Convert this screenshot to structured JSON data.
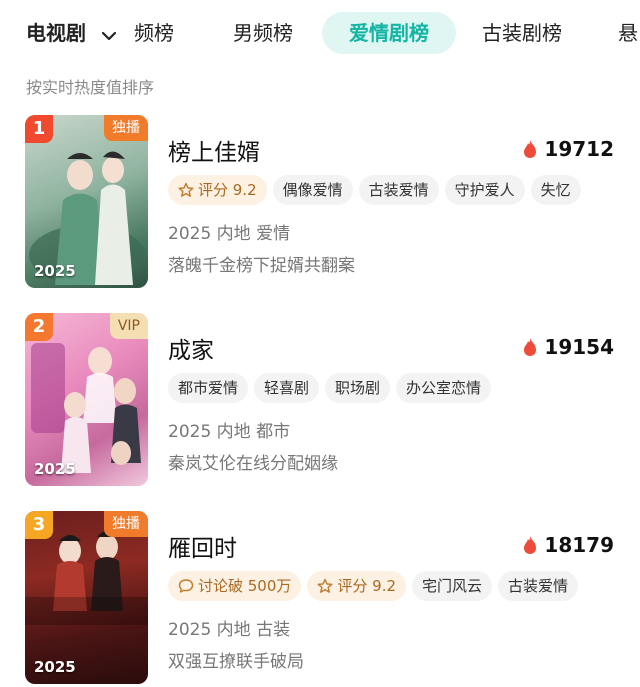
{
  "tabs": {
    "category": "电视剧",
    "items": [
      "频榜",
      "男频榜",
      "爱情剧榜",
      "古装剧榜",
      "悬"
    ]
  },
  "sort_hint": "按实时热度值排序",
  "colors": {
    "accent": "#14b5a3",
    "heat_flame": "#ee4b3a"
  },
  "items": [
    {
      "rank": "1",
      "corner_tag": "独播",
      "year": "2025",
      "title": "榜上佳婿",
      "heat": "19712",
      "tags": [
        "评分 9.2",
        "偶像爱情",
        "古装爱情",
        "守护爱人",
        "失忆"
      ],
      "meta": "2025 内地 爱情",
      "desc": "落魄千金榜下捉婿共翻案"
    },
    {
      "rank": "2",
      "corner_tag": "VIP",
      "year": "2025",
      "title": "成家",
      "heat": "19154",
      "tags": [
        "都市爱情",
        "轻喜剧",
        "职场剧",
        "办公室恋情"
      ],
      "meta": "2025 内地 都市",
      "desc": "秦岚艾伦在线分配姻缘"
    },
    {
      "rank": "3",
      "corner_tag": "独播",
      "year": "2025",
      "title": "雁回时",
      "heat": "18179",
      "tags": [
        "讨论破 500万",
        "评分 9.2",
        "宅门风云",
        "古装爱情"
      ],
      "meta": "2025 内地 古装",
      "desc": "双强互撩联手破局"
    }
  ]
}
